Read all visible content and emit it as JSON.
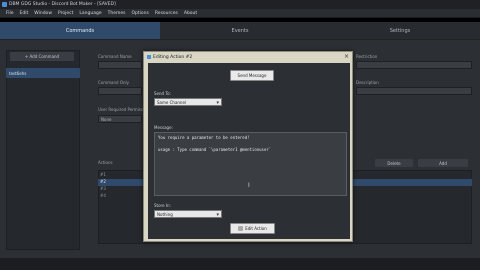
{
  "app": {
    "title": "DBM GDG Studio - Discord Bot Maker - [SAVED]"
  },
  "menu": [
    "File",
    "Edit",
    "Window",
    "Project",
    "Language",
    "Themes",
    "Options",
    "Resources",
    "About"
  ],
  "tabs": [
    "Commands",
    "Events",
    "Settings"
  ],
  "left_panel": {
    "add_button": "+ Add Command",
    "selected_item": "test6ehs"
  },
  "background": {
    "command_name_label": "Command Name",
    "command_only_label": "Command Only",
    "restriction_label": "Restriction",
    "user_required_label": "User Required Permissions",
    "user_required_value": "None",
    "description_label": "Description",
    "actions_label": "Actions",
    "table_rows": [
      "#1",
      "#2",
      "#3",
      "#4"
    ],
    "buttons": [
      "Delete",
      "Add"
    ]
  },
  "dialog": {
    "title": "Editing Action #2",
    "action_button": "Send Message",
    "send_to_label": "Send To:",
    "send_to_value": "Same Channel",
    "message_label": "Message:",
    "message_text": "You require a parameter to be entered!\n\nusage : Type command `\\parameter1 @mentionuser`",
    "store_in_label": "Store In:",
    "store_in_value": "Nothing",
    "edit_button": "Edit Action"
  }
}
